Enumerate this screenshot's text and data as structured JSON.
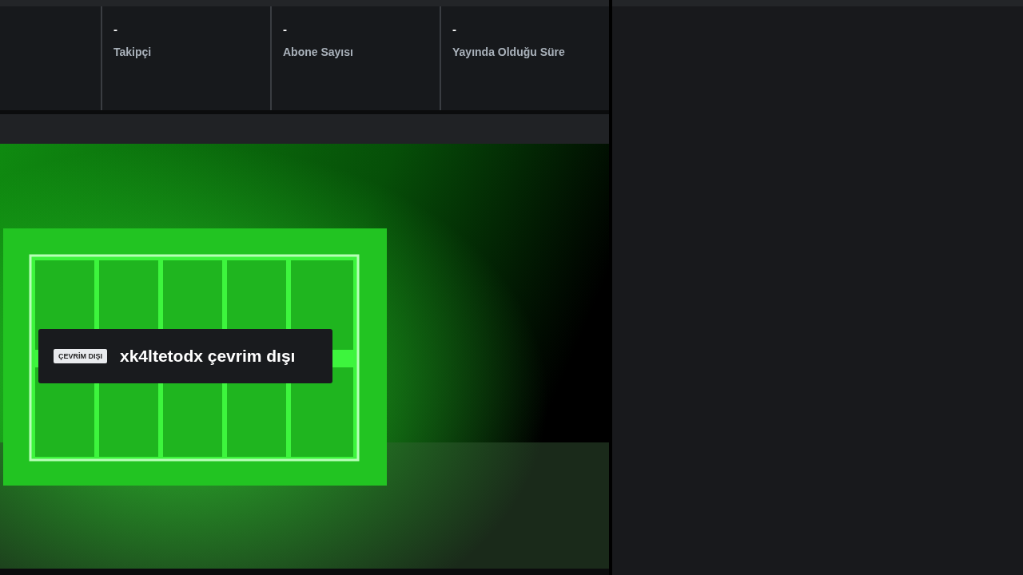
{
  "stats": [
    {
      "value": "-",
      "label": "Takipçi"
    },
    {
      "value": "-",
      "label": "Abone Sayısı"
    },
    {
      "value": "-",
      "label": "Yayında Olduğu Süre"
    }
  ],
  "player": {
    "badge": "ÇEVRİM DIŞI",
    "message": "xk4ltetodx çevrim dışı"
  }
}
